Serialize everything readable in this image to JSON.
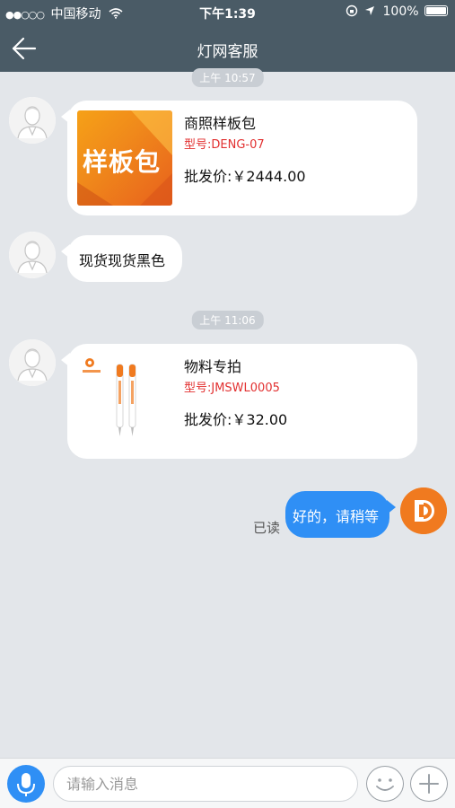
{
  "status_bar": {
    "carrier": "中国移动",
    "time": "下午1:39",
    "battery": "100%"
  },
  "navbar": {
    "title": "灯网客服"
  },
  "messages": {
    "time1": "上午 10:57",
    "product1": {
      "thumb_text": "样板包",
      "name": "商照样板包",
      "model": "型号:DENG-07",
      "price": "批发价:￥2444.00"
    },
    "text1": "现货现货黑色",
    "time2": "上午 11:06",
    "product2": {
      "name": "物料专拍",
      "model": "型号:JMSWL0005",
      "price": "批发价:￥32.00"
    },
    "reply": "好的，请稍等",
    "read_status": "已读"
  },
  "input_bar": {
    "placeholder": "请输入消息"
  },
  "icons": {
    "back": "back-arrow-icon",
    "mic": "microphone-icon",
    "emoji": "smiley-icon",
    "plus": "plus-icon"
  },
  "colors": {
    "header": "#4a5b66",
    "background": "#e3e6ea",
    "sent_bubble": "#2f8ff5",
    "model_red": "#e23030",
    "logo_orange": "#f07a1f"
  }
}
